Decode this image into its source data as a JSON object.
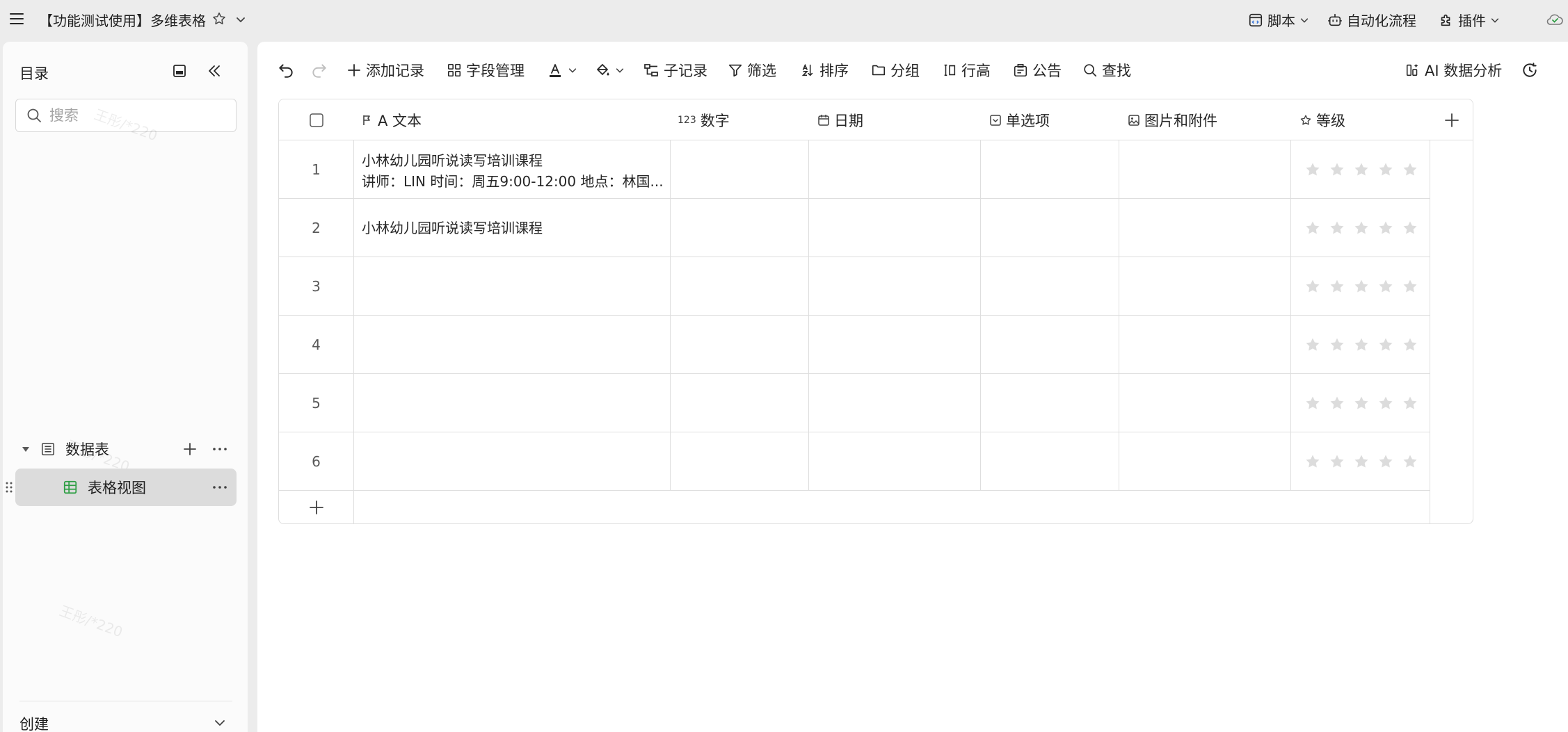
{
  "topbar": {
    "title": "【功能测试使用】多维表格",
    "script_label": "脚本",
    "automation_label": "自动化流程",
    "plugin_label": "插件"
  },
  "sidebar": {
    "title": "目录",
    "search_placeholder": "搜索",
    "group_label": "数据表",
    "view_label": "表格视图",
    "create_label": "创建",
    "watermark": "王彤/*220"
  },
  "toolbar": {
    "add_record": "添加记录",
    "field_manage": "字段管理",
    "sub_record": "子记录",
    "filter": "筛选",
    "sort": "排序",
    "group": "分组",
    "row_height": "行高",
    "notice": "公告",
    "find": "查找",
    "ai_analysis": "AI 数据分析"
  },
  "table": {
    "columns": [
      {
        "label": "A 文本",
        "icon": "flag-icon"
      },
      {
        "label": "数字",
        "icon": "number-icon"
      },
      {
        "label": "日期",
        "icon": "calendar-icon"
      },
      {
        "label": "单选项",
        "icon": "single-select-icon"
      },
      {
        "label": "图片和附件",
        "icon": "image-icon"
      },
      {
        "label": "等级",
        "icon": "star-icon"
      }
    ],
    "rows": [
      {
        "num": "1",
        "line1": "小林幼儿园听说读写培训课程",
        "line2": "讲师：LIN 时间：周五9:00-12:00 地点：林国...",
        "rating": 0
      },
      {
        "num": "2",
        "line1": "小林幼儿园听说读写培训课程",
        "line2": "",
        "rating": 0
      },
      {
        "num": "3",
        "line1": "",
        "line2": "",
        "rating": 0
      },
      {
        "num": "4",
        "line1": "",
        "line2": "",
        "rating": 0
      },
      {
        "num": "5",
        "line1": "",
        "line2": "",
        "rating": 0
      },
      {
        "num": "6",
        "line1": "",
        "line2": "",
        "rating": 0
      }
    ]
  },
  "colors": {
    "accent_green": "#2e9e44",
    "star_empty": "#dcdcdc",
    "border": "#dedede"
  }
}
